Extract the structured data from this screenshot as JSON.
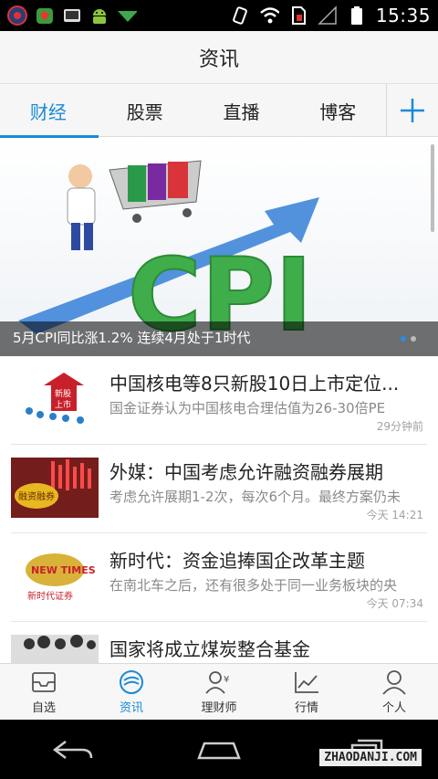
{
  "status_bar": {
    "time": "15:35",
    "left_icons": [
      "record-icon",
      "shield-app-icon",
      "screen-app-icon",
      "android-icon",
      "download-arrow-icon"
    ],
    "right_icons": [
      "vibrate-icon",
      "wifi-icon",
      "no-sim-icon",
      "signal-icon",
      "battery-icon"
    ]
  },
  "header": {
    "title": "资讯"
  },
  "tabs": [
    {
      "label": "财经",
      "active": true
    },
    {
      "label": "股票",
      "active": false
    },
    {
      "label": "直播",
      "active": false
    },
    {
      "label": "博客",
      "active": false
    }
  ],
  "banner": {
    "caption": "5月CPI同比涨1.2% 连续4月处于1时代",
    "image_text": "CPI",
    "dots": 2,
    "active_dot": 0
  },
  "news": [
    {
      "title": "中国核电等8只新股10日上市定位...",
      "summary": "国金证券认为中国核电合理估值为26-30倍PE",
      "time": "29分钟前",
      "thumb_text": [
        "新股",
        "上市"
      ]
    },
    {
      "title": "外媒：中国考虑允许融资融券展期",
      "summary": "考虑允许展期1-2次，每次6个月。最终方案仍未",
      "time": "今天 14:21",
      "thumb_text": [
        "融资融券"
      ]
    },
    {
      "title": "新时代：资金追捧国企改革主题",
      "summary": "在南北车之后，还有很多处于同一业务板块的央",
      "time": "今天 07:34",
      "thumb_text": [
        "NEW TIMES",
        "新时代证券"
      ]
    },
    {
      "title": "国家将成立煤炭整合基金",
      "summary": "",
      "time": "",
      "thumb_text": []
    }
  ],
  "bottom_nav": [
    {
      "label": "自选",
      "icon": "inbox-icon",
      "active": false
    },
    {
      "label": "资讯",
      "icon": "news-icon",
      "active": true
    },
    {
      "label": "理财师",
      "icon": "advisor-icon",
      "active": false
    },
    {
      "label": "行情",
      "icon": "market-chart-icon",
      "active": false
    },
    {
      "label": "个人",
      "icon": "person-icon",
      "active": false
    }
  ],
  "watermark": "ZHAODANJI.COM",
  "colors": {
    "accent": "#1a8ad8",
    "text": "#222222",
    "muted": "#8a8a8a"
  }
}
